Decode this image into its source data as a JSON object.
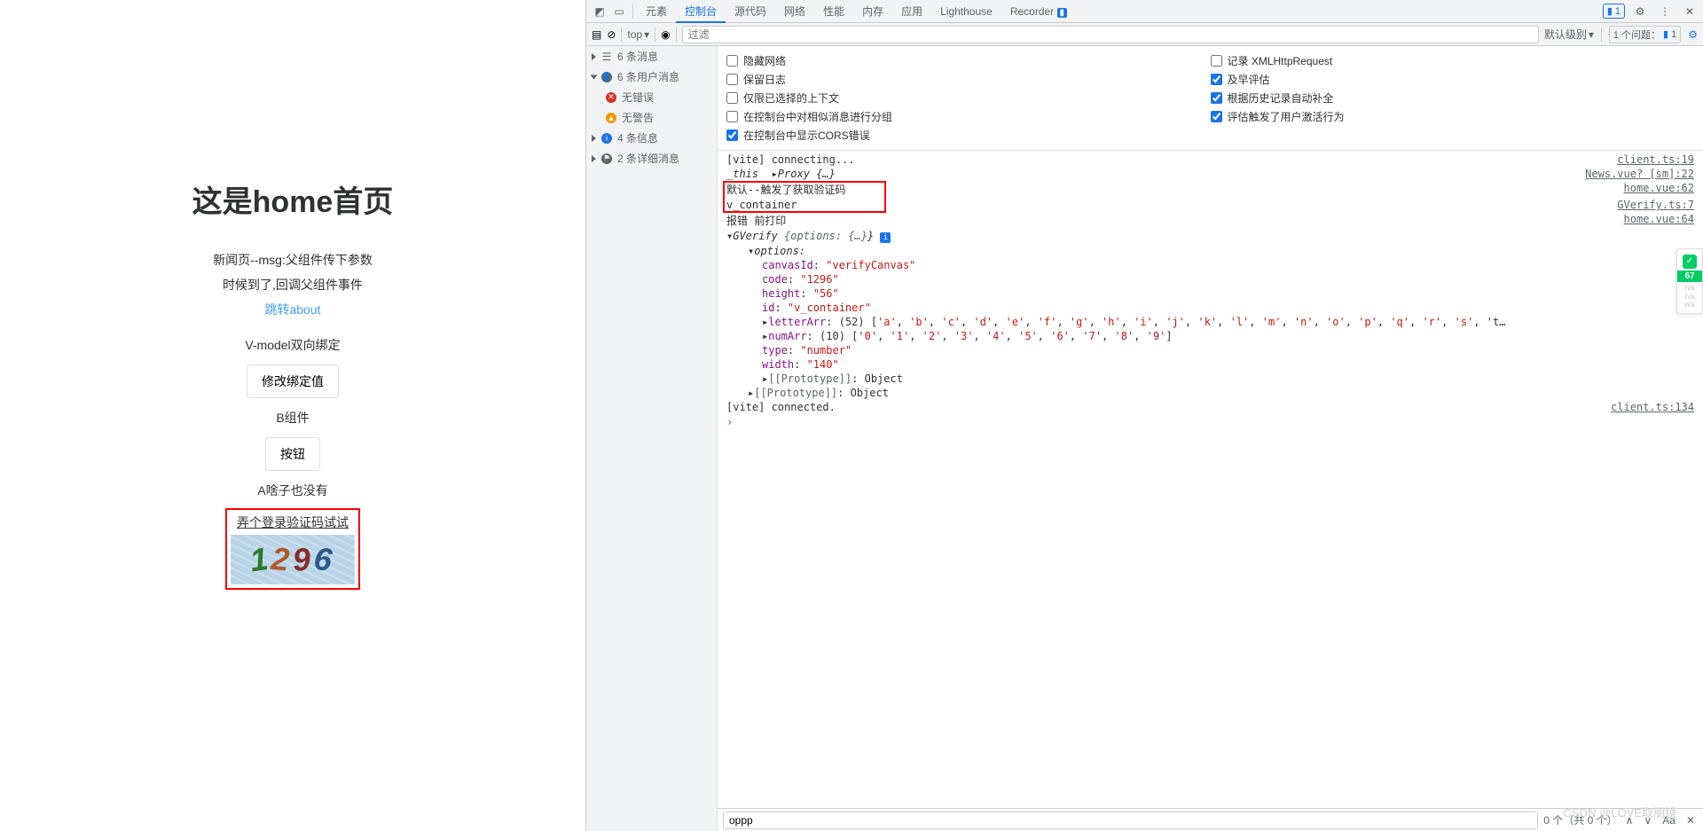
{
  "page": {
    "title": "这是home首页",
    "news_line": "新闻页--msg:父组件传下参数",
    "callback_line": "时候到了,回调父组件事件",
    "about_link": "跳转about",
    "vmodel_label": "V-model双向绑定",
    "modify_btn": "修改绑定值",
    "b_component": "B组件",
    "button_label": "按钮",
    "a_nothing": "A啥子也没有",
    "captcha_title": "弄个登录验证码试试",
    "captcha_code": "1296"
  },
  "devtools": {
    "tabs": [
      "元素",
      "控制台",
      "源代码",
      "网络",
      "性能",
      "内存",
      "应用",
      "Lighthouse",
      "Recorder"
    ],
    "active_tab": "控制台",
    "errors_chip": "1",
    "toolbar": {
      "context": "top",
      "filter_placeholder": "过滤",
      "level": "默认级别",
      "issues_label": "1 个问题：",
      "issues_count": "1"
    },
    "sidebar": {
      "msgs": "6 条消息",
      "user_msgs": "6 条用户消息",
      "no_errors": "无错误",
      "no_warnings": "无警告",
      "info": "4 条信息",
      "verbose": "2 条详细消息"
    },
    "settings": {
      "col1": [
        "隐藏网络",
        "保留日志",
        "仅限已选择的上下文",
        "在控制台中对相似消息进行分组",
        "在控制台中显示CORS错误"
      ],
      "col1_checked": [
        false,
        false,
        false,
        false,
        true
      ],
      "col2": [
        "记录 XMLHttpRequest",
        "及早评估",
        "根据历史记录自动补全",
        "评估触发了用户激活行为"
      ],
      "col2_checked": [
        false,
        true,
        true,
        true
      ]
    },
    "log": [
      {
        "msg": "[vite] connecting...",
        "src": "client.ts:19"
      },
      {
        "msg": "_this  ▸Proxy {…}",
        "src": "News.vue? [sm]:22",
        "italic": true
      },
      {
        "msg": "默认--触发了获取验证码",
        "src": "home.vue:62",
        "boxed": true
      },
      {
        "msg": "v_container",
        "src": "GVerify.ts:7"
      },
      {
        "msg": "报错 前打印",
        "src": "home.vue:64"
      },
      {
        "msg": "▾GVerify {options: {…}} ℹ",
        "obj": true
      },
      {
        "msg": "▾options:",
        "indent": 1,
        "obj": true
      },
      {
        "msg": "canvasId: \"verifyCanvas\"",
        "indent": 2,
        "kv": true,
        "k": "canvasId",
        "v": "\"verifyCanvas\""
      },
      {
        "msg": "code: \"1296\"",
        "indent": 2,
        "kv": true,
        "k": "code",
        "v": "\"1296\""
      },
      {
        "msg": "height: \"56\"",
        "indent": 2,
        "kv": true,
        "k": "height",
        "v": "\"56\""
      },
      {
        "msg": "id: \"v_container\"",
        "indent": 2,
        "kv": true,
        "k": "id",
        "v": "\"v_container\""
      },
      {
        "msg": "▸letterArr: (52) ['a', 'b', 'c', 'd', 'e', 'f', 'g', 'h', 'i', 'j', 'k', 'l', 'm', 'n', 'o', 'p', 'q', 'r', 's', 't…",
        "indent": 2,
        "arr": true,
        "k": "letterArr"
      },
      {
        "msg": "▸numArr: (10) ['0', '1', '2', '3', '4', '5', '6', '7', '8', '9']",
        "indent": 2,
        "arr": true,
        "k": "numArr"
      },
      {
        "msg": "type: \"number\"",
        "indent": 2,
        "kv": true,
        "k": "type",
        "v": "\"number\""
      },
      {
        "msg": "width: \"140\"",
        "indent": 2,
        "kv": true,
        "k": "width",
        "v": "\"140\""
      },
      {
        "msg": "▸[[Prototype]]: Object",
        "indent": 2,
        "proto": true
      },
      {
        "msg": "▸[[Prototype]]: Object",
        "indent": 1,
        "proto": true
      },
      {
        "msg": "[vite] connected.",
        "src": "client.ts:134"
      }
    ],
    "prompt": "›",
    "search": {
      "value": "oppp",
      "count": "0 个（共 0 个）",
      "aa": "Aa"
    }
  },
  "watermark": "CSDN @LOVE取朋镜",
  "perf": {
    "score": "67"
  }
}
